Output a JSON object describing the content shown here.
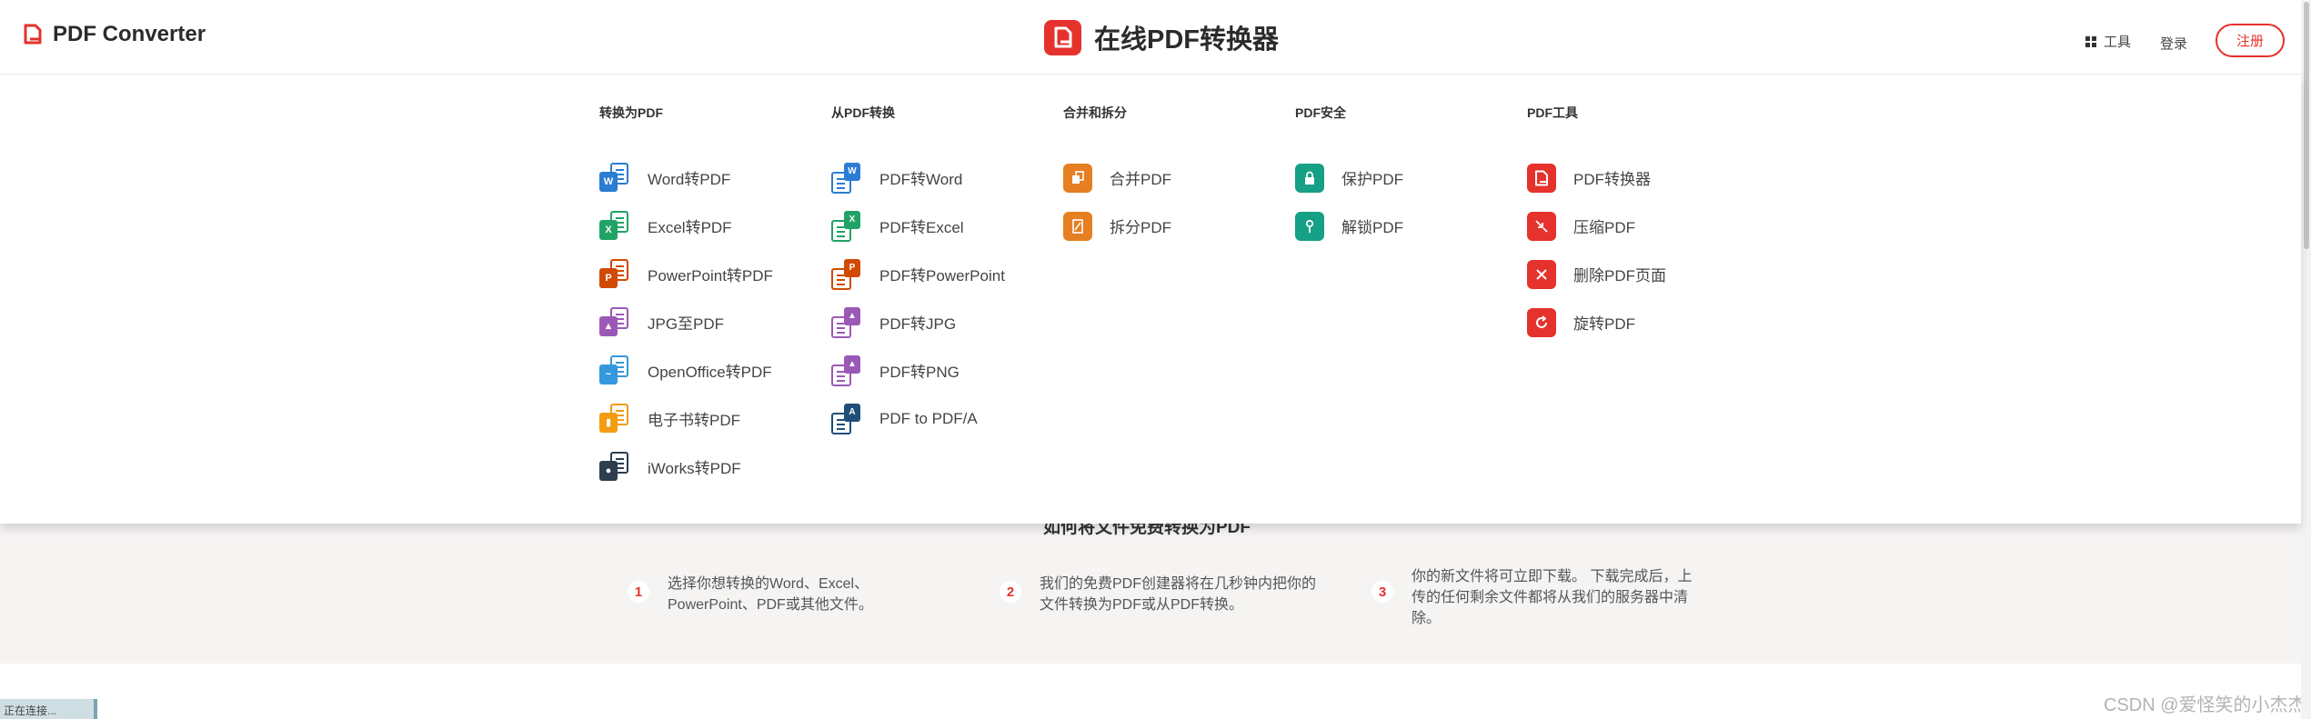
{
  "header": {
    "brand": "PDF Converter",
    "center_title": "在线PDF转换器",
    "tools_label": "工具",
    "login_label": "登录",
    "signup_label": "注册"
  },
  "menu": {
    "columns": [
      {
        "title": "转换为PDF",
        "items": [
          {
            "label": "Word转PDF",
            "icon": "word-to-pdf-icon",
            "badge": "W",
            "color": "#2b7cd3"
          },
          {
            "label": "Excel转PDF",
            "icon": "excel-to-pdf-icon",
            "badge": "X",
            "color": "#21a366"
          },
          {
            "label": "PowerPoint转PDF",
            "icon": "powerpoint-to-pdf-icon",
            "badge": "P",
            "color": "#d04a02"
          },
          {
            "label": "JPG至PDF",
            "icon": "jpg-to-pdf-icon",
            "badge": "▲",
            "color": "#9b59b6"
          },
          {
            "label": "OpenOffice转PDF",
            "icon": "openoffice-to-pdf-icon",
            "badge": "~",
            "color": "#3498db"
          },
          {
            "label": "电子书转PDF",
            "icon": "ebook-to-pdf-icon",
            "badge": "▮",
            "color": "#f39c12"
          },
          {
            "label": "iWorks转PDF",
            "icon": "iworks-to-pdf-icon",
            "badge": "●",
            "color": "#2c3e50"
          }
        ]
      },
      {
        "title": "从PDF转换",
        "items": [
          {
            "label": "PDF转Word",
            "icon": "pdf-to-word-icon",
            "badge": "W",
            "color": "#2b7cd3"
          },
          {
            "label": "PDF转Excel",
            "icon": "pdf-to-excel-icon",
            "badge": "X",
            "color": "#21a366"
          },
          {
            "label": "PDF转PowerPoint",
            "icon": "pdf-to-powerpoint-icon",
            "badge": "P",
            "color": "#d04a02"
          },
          {
            "label": "PDF转JPG",
            "icon": "pdf-to-jpg-icon",
            "badge": "▲",
            "color": "#9b59b6"
          },
          {
            "label": "PDF转PNG",
            "icon": "pdf-to-png-icon",
            "badge": "▲",
            "color": "#9b59b6"
          },
          {
            "label": "PDF to PDF/A",
            "icon": "pdf-to-pdfa-icon",
            "badge": "A",
            "color": "#1f4e79"
          }
        ]
      },
      {
        "title": "合并和拆分",
        "items": [
          {
            "label": "合并PDF",
            "icon": "merge-pdf-icon",
            "color": "#e67e22"
          },
          {
            "label": "拆分PDF",
            "icon": "split-pdf-icon",
            "color": "#e67e22"
          }
        ]
      },
      {
        "title": "PDF安全",
        "items": [
          {
            "label": "保护PDF",
            "icon": "lock-icon",
            "color": "#16a085"
          },
          {
            "label": "解锁PDF",
            "icon": "unlock-icon",
            "color": "#16a085"
          }
        ]
      },
      {
        "title": "PDF工具",
        "items": [
          {
            "label": "PDF转换器",
            "icon": "pdf-converter-icon",
            "color": "#e5322d"
          },
          {
            "label": "压缩PDF",
            "icon": "compress-pdf-icon",
            "color": "#e5322d"
          },
          {
            "label": "删除PDF页面",
            "icon": "delete-pages-icon",
            "color": "#e5322d"
          },
          {
            "label": "旋转PDF",
            "icon": "rotate-pdf-icon",
            "color": "#e5322d"
          }
        ]
      }
    ]
  },
  "how_to": {
    "title": "如何将文件免费转换为PDF",
    "steps": [
      {
        "num": "1",
        "text_line1": "选择你想转换的Word、Excel、",
        "text_line2": "PowerPoint、PDF或其他文件。",
        "text_line3": ""
      },
      {
        "num": "2",
        "text_line1": "我们的免费PDF创建器将在几秒钟内把你的",
        "text_line2": "文件转换为PDF或从PDF转换。",
        "text_line3": ""
      },
      {
        "num": "3",
        "text_line1": "你的新文件将可立即下载。 下载完成后，上",
        "text_line2": "传的任何剩余文件都将从我们的服务器中清",
        "text_line3": "除。"
      }
    ]
  },
  "status": "正在连接...",
  "watermark": "CSDN @爱怪笑的小杰杰"
}
